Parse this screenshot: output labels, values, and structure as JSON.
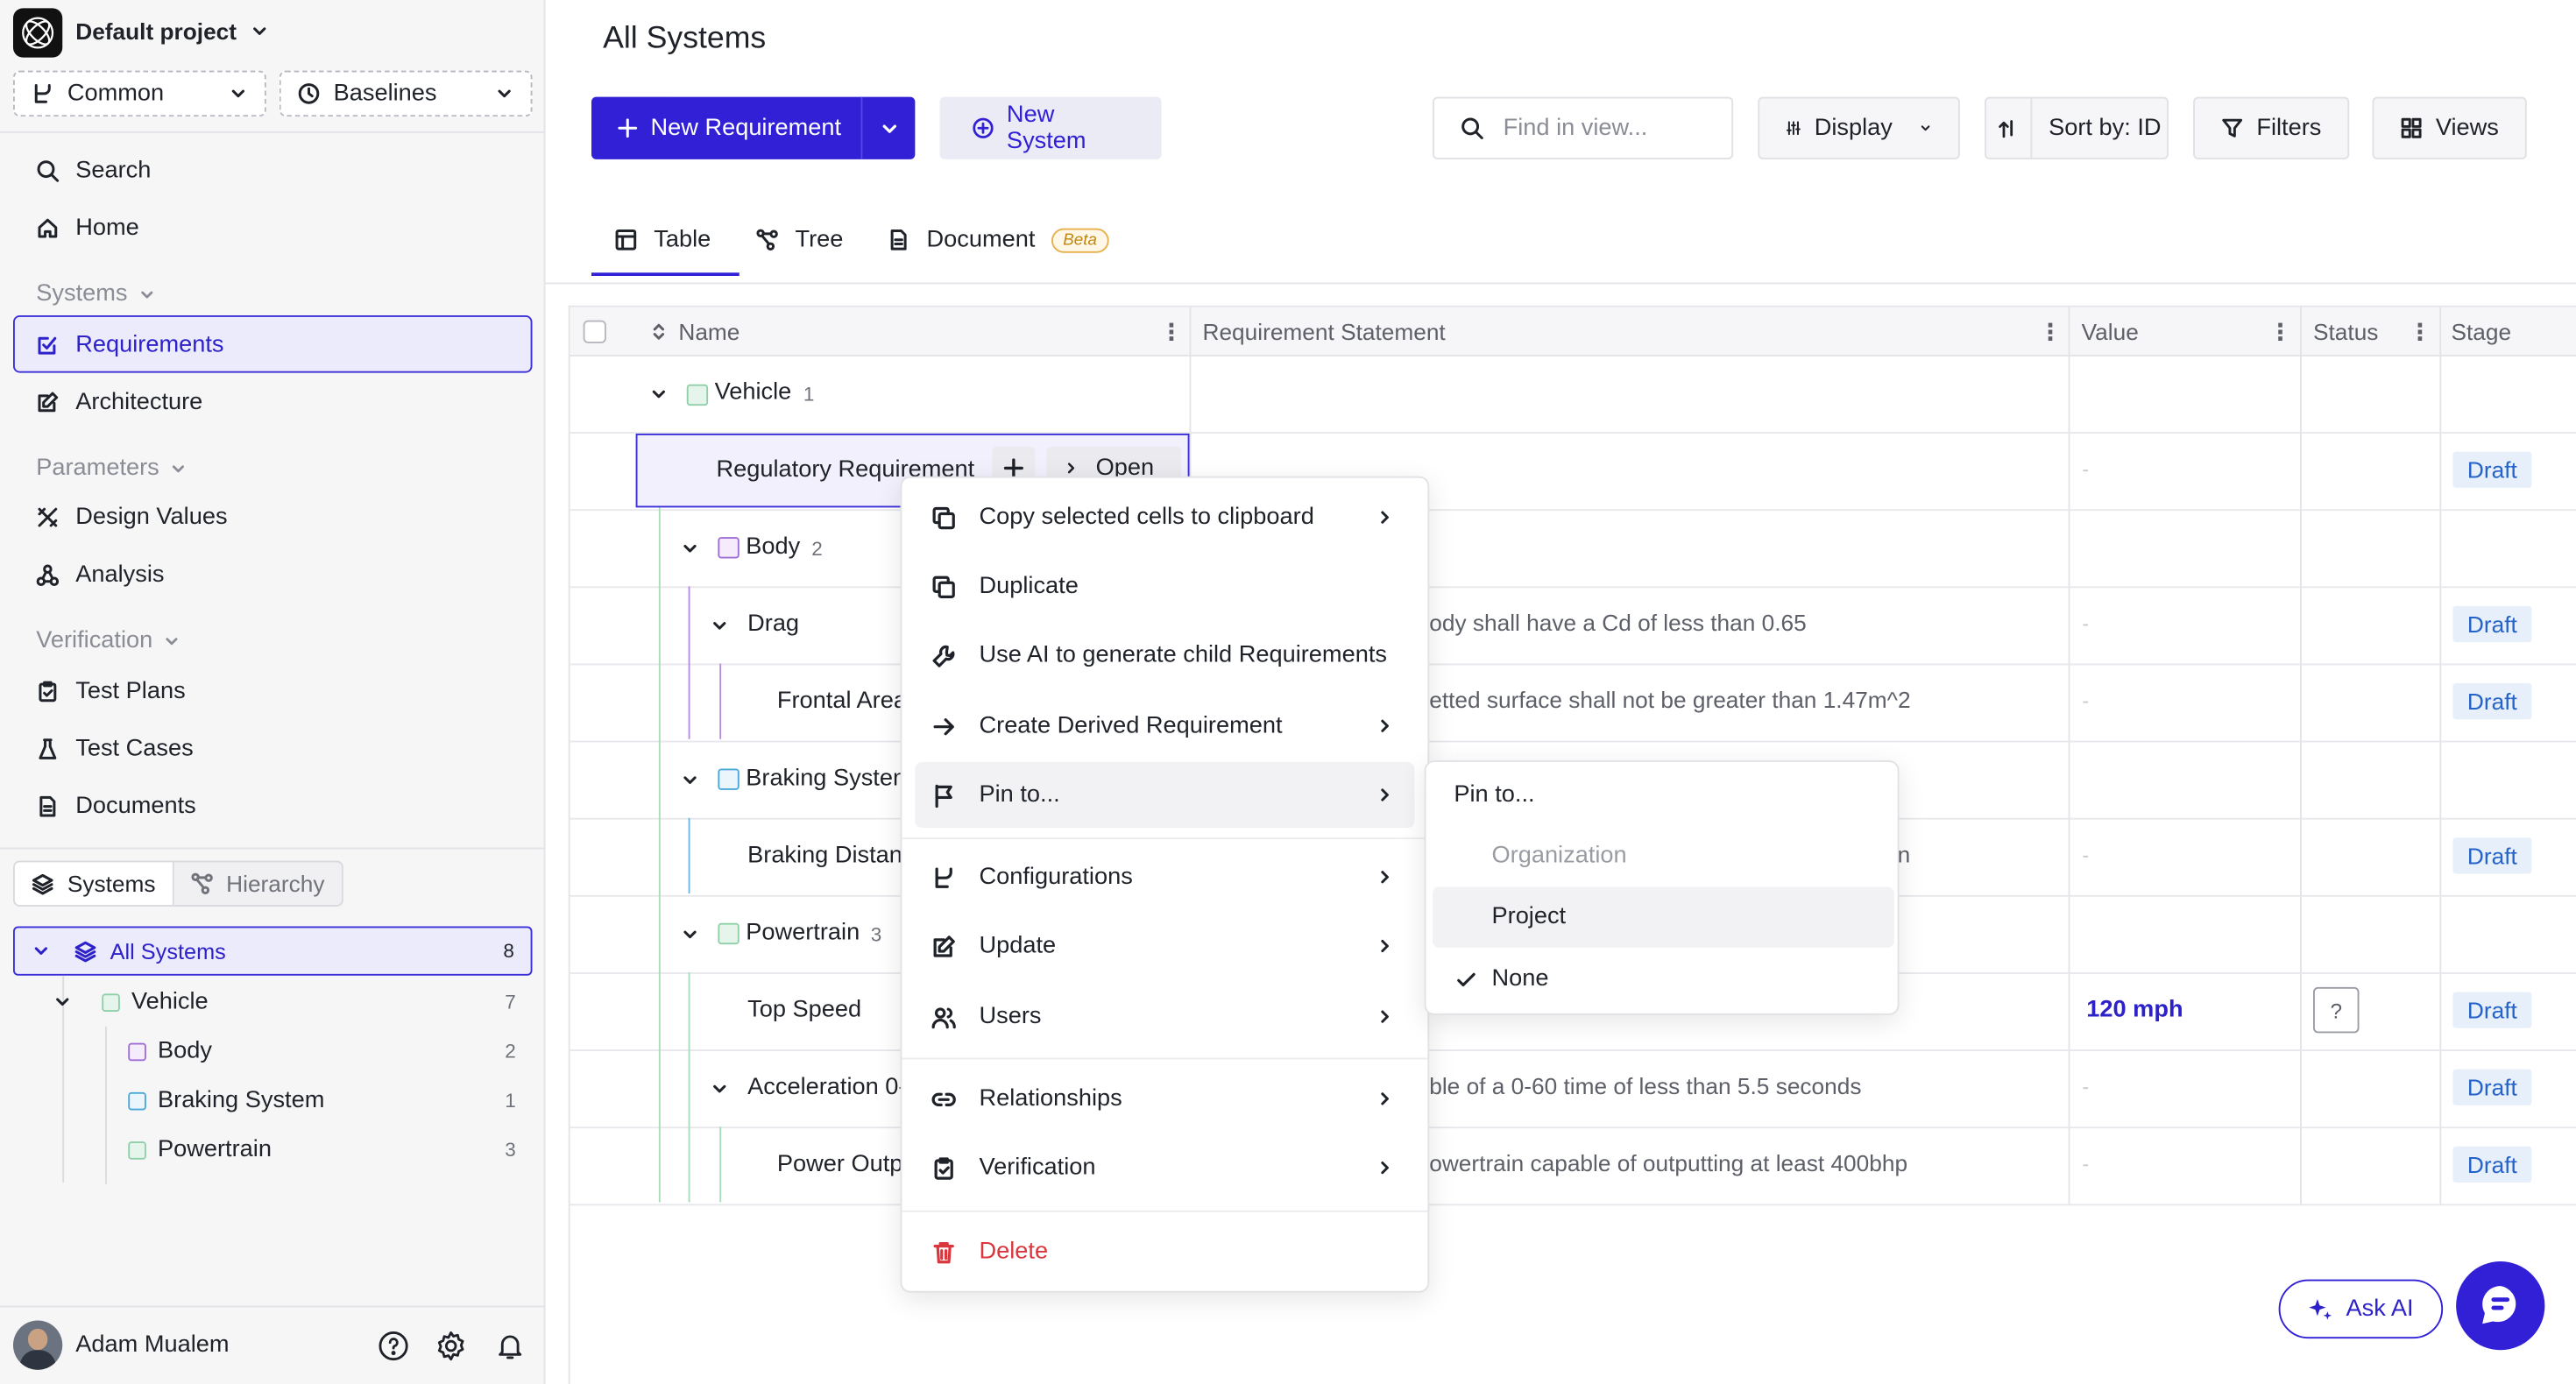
{
  "project": {
    "name": "Default project"
  },
  "selectors": {
    "common": "Common",
    "baselines": "Baselines"
  },
  "nav": {
    "search": "Search",
    "home": "Home",
    "systems_section": "Systems",
    "requirements": "Requirements",
    "architecture": "Architecture",
    "parameters_section": "Parameters",
    "design_values": "Design Values",
    "analysis": "Analysis",
    "verification_section": "Verification",
    "test_plans": "Test Plans",
    "test_cases": "Test Cases",
    "documents": "Documents"
  },
  "segment": {
    "systems": "Systems",
    "hierarchy": "Hierarchy"
  },
  "system_tree": {
    "all": {
      "label": "All Systems",
      "count": "8"
    },
    "vehicle": {
      "label": "Vehicle",
      "count": "7"
    },
    "body": {
      "label": "Body",
      "count": "2"
    },
    "braking": {
      "label": "Braking System",
      "count": "1"
    },
    "powertrain": {
      "label": "Powertrain",
      "count": "3"
    }
  },
  "user": {
    "name": "Adam Mualem"
  },
  "page": {
    "title": "All Systems"
  },
  "toolbar": {
    "new_requirement": "New Requirement",
    "new_system": "New System",
    "find_placeholder": "Find in view...",
    "display": "Display",
    "sort": "Sort by: ID",
    "filters": "Filters",
    "views": "Views"
  },
  "tabs": {
    "table": "Table",
    "tree": "Tree",
    "document": "Document",
    "beta": "Beta"
  },
  "columns": {
    "name": "Name",
    "statement": "Requirement Statement",
    "value": "Value",
    "status": "Status",
    "stage": "Stage"
  },
  "rows": {
    "vehicle": "Vehicle",
    "vehicle_count": "1",
    "regulatory": "Regulatory Requirement",
    "open": "Open",
    "body": "Body",
    "body_count": "2",
    "drag": "Drag",
    "drag_stmt": "ody shall have a Cd of less than 0.65",
    "frontal": "Frontal Area",
    "frontal_stmt": "etted surface shall not be greater than 1.47m^2",
    "braking": "Braking System",
    "braking_dist": "Braking Distance",
    "braking_stmt": "n",
    "powertrain": "Powertrain",
    "powertrain_count": "3",
    "top_speed": "Top Speed",
    "top_speed_value": "120 mph",
    "status_unknown": "?",
    "accel": "Acceleration 0-60",
    "accel_stmt": "ble of a 0-60 time of less than 5.5 seconds",
    "power": "Power Output",
    "power_stmt": "owertrain capable of outputting at least 400bhp",
    "draft": "Draft"
  },
  "context_menu": {
    "copy": "Copy selected cells to clipboard",
    "duplicate": "Duplicate",
    "ai_generate": "Use AI to generate child Requirements",
    "derived": "Create Derived Requirement",
    "pin": "Pin to...",
    "configurations": "Configurations",
    "update": "Update",
    "users": "Users",
    "relationships": "Relationships",
    "verification": "Verification",
    "delete": "Delete"
  },
  "pin_submenu": {
    "title": "Pin to...",
    "organization": "Organization",
    "project": "Project",
    "none": "None"
  },
  "ask_ai": "Ask AI",
  "colors": {
    "accent": "#3120d6",
    "draft_bg": "#e6effa",
    "draft_text": "#2563c9",
    "delete": "#d9363e"
  }
}
